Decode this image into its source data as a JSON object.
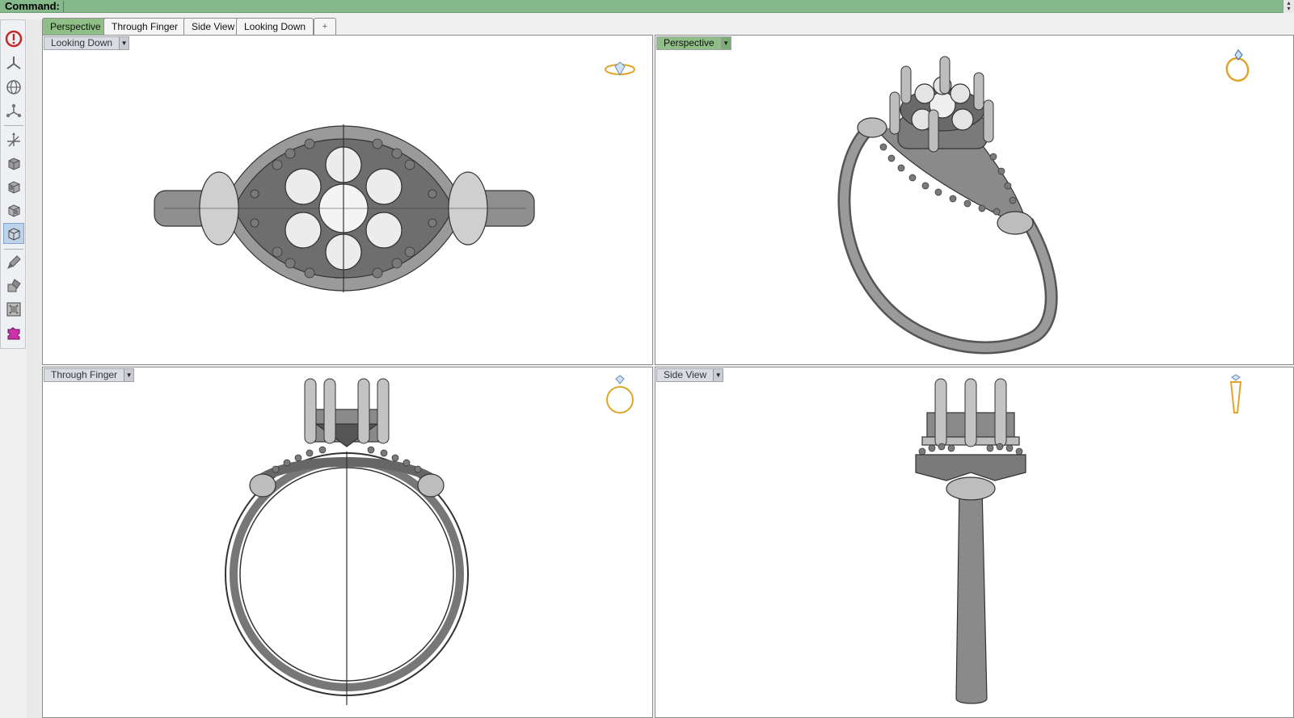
{
  "command": {
    "label": "Command:",
    "value": ""
  },
  "tabs": [
    {
      "label": "Perspective",
      "active": true
    },
    {
      "label": "Through Finger",
      "active": false
    },
    {
      "label": "Side View",
      "active": false
    },
    {
      "label": "Looking Down",
      "active": false
    },
    {
      "label": "+",
      "active": false
    }
  ],
  "toolbar": {
    "buttons": [
      {
        "icon": "rhinogold-logo-icon"
      },
      {
        "icon": "axis-icon"
      },
      {
        "icon": "globe-icon"
      },
      {
        "icon": "nodes-icon"
      },
      {
        "icon": "axes-move-icon"
      },
      {
        "icon": "cube-view-1-icon"
      },
      {
        "icon": "cube-view-2-icon"
      },
      {
        "icon": "cube-view-3-icon"
      },
      {
        "icon": "cube-view-4-icon",
        "selected": true
      },
      {
        "icon": "paint-brush-icon"
      },
      {
        "icon": "material-icon"
      },
      {
        "icon": "render-box-icon"
      },
      {
        "icon": "settings-puzzle-icon"
      }
    ]
  },
  "viewports": {
    "top_left": {
      "label": "Looking Down",
      "active": false,
      "nav_icon": "ring-top-view-icon"
    },
    "top_right": {
      "label": "Perspective",
      "active": true,
      "nav_icon": "ring-perspective-icon"
    },
    "bottom_left": {
      "label": "Through Finger",
      "active": false,
      "nav_icon": "ring-front-view-icon"
    },
    "bottom_right": {
      "label": "Side View",
      "active": false,
      "nav_icon": "ring-side-view-icon"
    }
  },
  "colors": {
    "tab_active": "#8fbf86",
    "command_bar": "#85b88a",
    "gold": "#e0a62a",
    "wire": "#333333"
  }
}
